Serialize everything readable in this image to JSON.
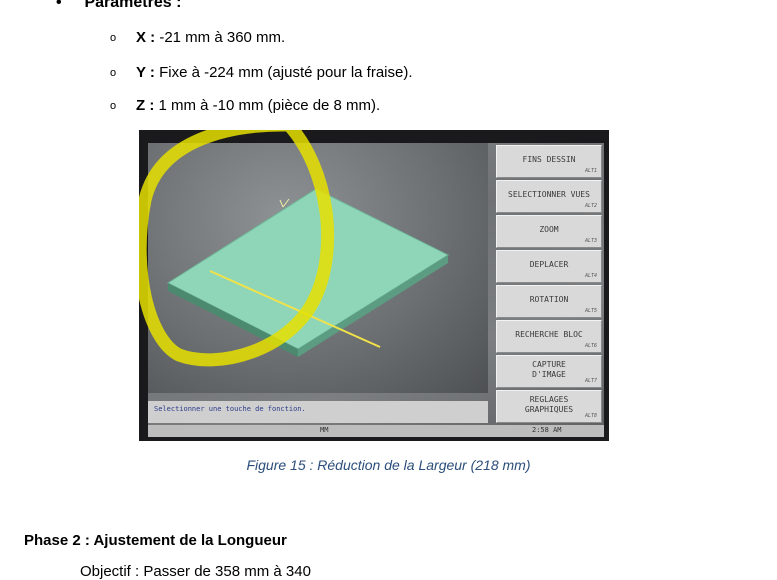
{
  "params_label": "Paramètres :",
  "params": [
    {
      "axis": "X :",
      "text": " -21 mm à 360 mm."
    },
    {
      "axis": "Y :",
      "text": " Fixe à -224 mm (ajusté pour la fraise)."
    },
    {
      "axis": "Z :",
      "text": " 1 mm à -10 mm (pièce de 8 mm)."
    }
  ],
  "screen": {
    "menu": [
      {
        "label": "FINS DESSIN",
        "alt": "ALT1"
      },
      {
        "label": "SELECTIONNER VUES",
        "alt": "ALT2"
      },
      {
        "label": "ZOOM",
        "alt": "ALT3"
      },
      {
        "label": "DEPLACER",
        "alt": "ALT4"
      },
      {
        "label": "ROTATION",
        "alt": "ALT5"
      },
      {
        "label": "RECHERCHE BLOC",
        "alt": "ALT6"
      },
      {
        "label": "CAPTURE D'IMAGE",
        "alt": "ALT7"
      },
      {
        "label": "REGLAGES GRAPHIQUES",
        "alt": "ALT8"
      }
    ],
    "status_message": "Selectionner une touche de fonction.",
    "unit": "MM",
    "clock": "2:58 AM"
  },
  "caption": "Figure 15 :  Réduction de la Largeur (218 mm)",
  "phase_title": "Phase 2 : Ajustement de la Longueur",
  "cut_text": "Objectif : Passer de 358 mm à 340"
}
